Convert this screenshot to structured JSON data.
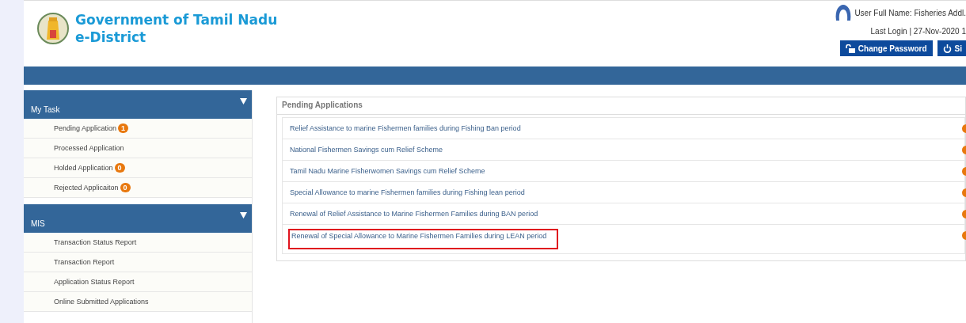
{
  "header": {
    "title": "Government of Tamil Nadu",
    "subtitle": "e-District",
    "user": "User Full Name: Fisheries Addl.",
    "last_login": "Last Login | 27-Nov-2020 1",
    "buttons": [
      {
        "kind": "password",
        "label": "Change Password"
      },
      {
        "kind": "signout",
        "label": "Si"
      }
    ]
  },
  "sidebar": [
    {
      "title": "My Task",
      "expanded": true,
      "items": [
        {
          "label": "Pending Application",
          "badge": "1"
        },
        {
          "label": "Processed Application"
        },
        {
          "label": "Holded Application",
          "badge": "0"
        },
        {
          "label": "Rejected Applicaiton",
          "badge": "0"
        }
      ]
    },
    {
      "title": "MIS",
      "expanded": true,
      "items": [
        {
          "label": "Transaction Status Report"
        },
        {
          "label": "Transaction Report"
        },
        {
          "label": "Application Status Report"
        },
        {
          "label": "Online Submitted Applications"
        }
      ]
    }
  ],
  "panel": {
    "title": "Pending Applications",
    "items": [
      {
        "label": "Relief Assistance to marine Fishermen families during Fishing Ban period",
        "highlighted": false
      },
      {
        "label": "National Fishermen Savings cum Relief Scheme",
        "highlighted": false
      },
      {
        "label": "Tamil Nadu Marine Fisherwomen Savings cum Relief Scheme",
        "highlighted": false
      },
      {
        "label": "Special Allowance to marine Fishermen families during Fishing lean period",
        "highlighted": false
      },
      {
        "label": "Renewal of Relief Assistance to Marine Fishermen Families during BAN period",
        "highlighted": false
      },
      {
        "label": "Renewal of Special Allowance to Marine Fishermen Families during LEAN period",
        "highlighted": true
      }
    ]
  }
}
